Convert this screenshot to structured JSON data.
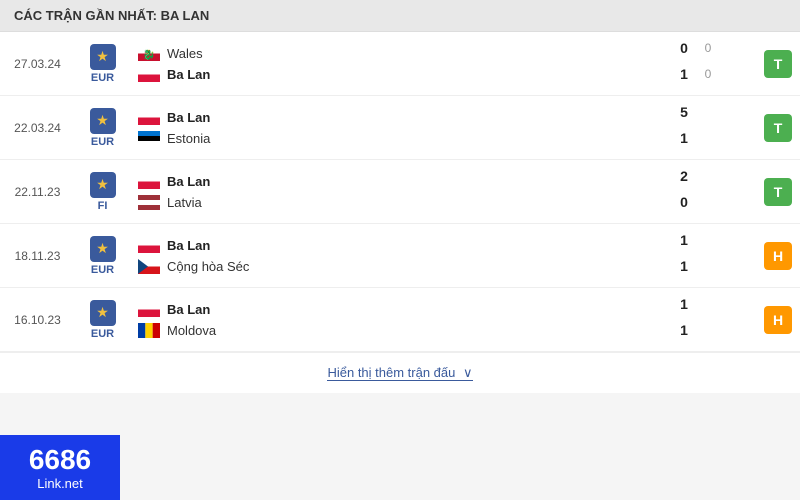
{
  "header": {
    "title": "CÁC TRẬN GẦN NHẤT: BA LAN"
  },
  "matches": [
    {
      "date": "27.03.24",
      "tournament": "EUR",
      "teams": [
        {
          "name": "Wales",
          "flag": "wales",
          "bold": false,
          "score": "0",
          "subscore": "0"
        },
        {
          "name": "Ba Lan",
          "flag": "poland",
          "bold": true,
          "score": "1",
          "subscore": "0"
        }
      ],
      "result": "T",
      "result_type": "win"
    },
    {
      "date": "22.03.24",
      "tournament": "EUR",
      "teams": [
        {
          "name": "Ba Lan",
          "flag": "poland",
          "bold": true,
          "score": "5",
          "subscore": ""
        },
        {
          "name": "Estonia",
          "flag": "estonia",
          "bold": false,
          "score": "1",
          "subscore": ""
        }
      ],
      "result": "T",
      "result_type": "win"
    },
    {
      "date": "22.11.23",
      "tournament": "FI",
      "teams": [
        {
          "name": "Ba Lan",
          "flag": "poland",
          "bold": true,
          "score": "2",
          "subscore": ""
        },
        {
          "name": "Latvia",
          "flag": "latvia",
          "bold": false,
          "score": "0",
          "subscore": ""
        }
      ],
      "result": "T",
      "result_type": "win"
    },
    {
      "date": "18.11.23",
      "tournament": "EUR",
      "teams": [
        {
          "name": "Ba Lan",
          "flag": "poland",
          "bold": true,
          "score": "1",
          "subscore": ""
        },
        {
          "name": "Cộng hòa Séc",
          "flag": "czech",
          "bold": false,
          "score": "1",
          "subscore": ""
        }
      ],
      "result": "H",
      "result_type": "draw"
    },
    {
      "date": "16.10.23",
      "tournament": "EUR",
      "teams": [
        {
          "name": "Ba Lan",
          "flag": "poland",
          "bold": true,
          "score": "1",
          "subscore": ""
        },
        {
          "name": "Moldova",
          "flag": "moldova",
          "bold": false,
          "score": "1",
          "subscore": ""
        }
      ],
      "result": "H",
      "result_type": "draw"
    }
  ],
  "show_more": {
    "label": "Hiển thị thêm trận đấu",
    "chevron": "∨"
  },
  "logo": {
    "number": "6686",
    "text": "Link.net"
  }
}
